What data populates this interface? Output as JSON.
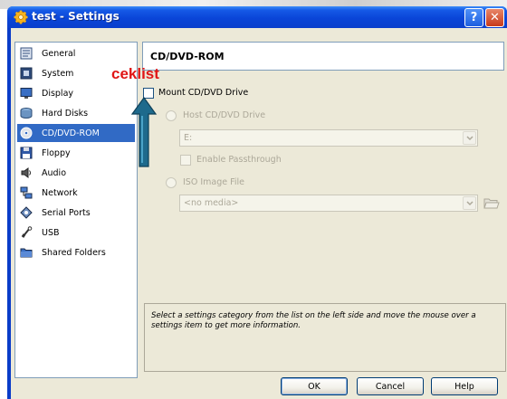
{
  "window": {
    "title": "test - Settings",
    "title_icon": "gear-icon",
    "help_label": "?",
    "close_label": "✕"
  },
  "sidebar": {
    "items": [
      {
        "label": "General",
        "icon": "general-icon"
      },
      {
        "label": "System",
        "icon": "system-icon"
      },
      {
        "label": "Display",
        "icon": "display-icon"
      },
      {
        "label": "Hard Disks",
        "icon": "hard-disk-icon"
      },
      {
        "label": "CD/DVD-ROM",
        "icon": "cd-icon",
        "selected": true
      },
      {
        "label": "Floppy",
        "icon": "floppy-icon"
      },
      {
        "label": "Audio",
        "icon": "audio-icon"
      },
      {
        "label": "Network",
        "icon": "network-icon"
      },
      {
        "label": "Serial Ports",
        "icon": "serial-port-icon"
      },
      {
        "label": "USB",
        "icon": "usb-icon"
      },
      {
        "label": "Shared Folders",
        "icon": "shared-folder-icon"
      }
    ]
  },
  "panel": {
    "title": "CD/DVD-ROM",
    "mount_checkbox_label": "Mount CD/DVD Drive",
    "mount_checked": false,
    "host_drive_label": "Host CD/DVD Drive",
    "host_drive_value": "E:",
    "passthrough_label": "Enable Passthrough",
    "iso_label": "ISO Image File",
    "iso_value": "<no media>"
  },
  "info": {
    "text": "Select a settings category from the list on the left side and move the mouse over a settings item to get more information."
  },
  "buttons": {
    "ok": "OK",
    "cancel": "Cancel",
    "help": "Help"
  },
  "annotation": {
    "text": "ceklist",
    "color": "#e01616",
    "arrow_color": "#1e6a8c"
  },
  "colors": {
    "titlebar": "#0a45d8",
    "selection": "#316ac5",
    "dialog_bg": "#ece9d8"
  }
}
